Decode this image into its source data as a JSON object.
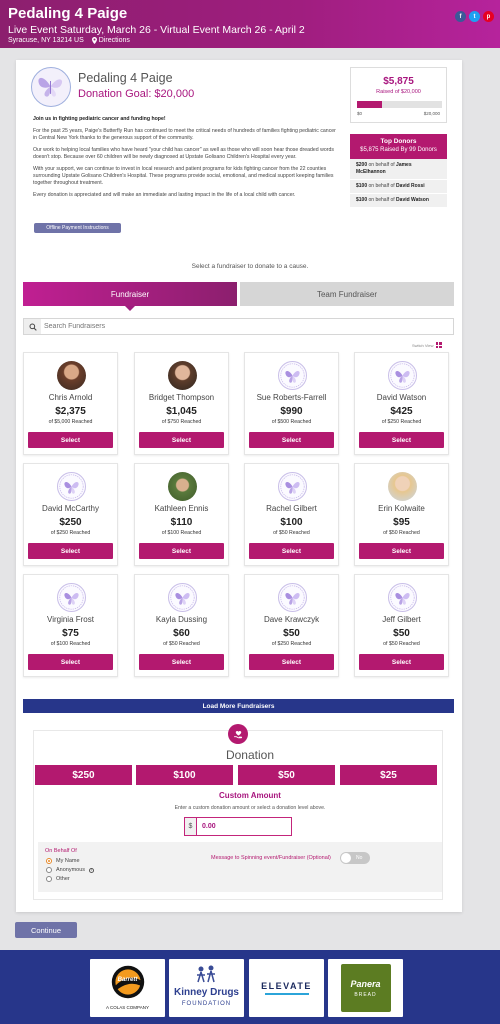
{
  "header": {
    "title": "Pedaling 4 Paige",
    "event_line": "Live Event Saturday, March 26 - Virtual Event March 26 - April 2",
    "location": "Syracuse, NY 13214 US",
    "directions": "Directions",
    "social": [
      "f",
      "t",
      "p"
    ]
  },
  "campaign": {
    "title": "Pedaling 4 Paige",
    "goal_label": "Donation Goal: $20,000",
    "story": [
      "Join us in fighting pediatric cancer and funding hope!",
      "For the past 25 years, Paige's Butterfly Run has continued to meet the critical needs of hundreds of families fighting pediatric cancer in Central New York thanks to the generous support of the community.",
      "Our work to helping local families who have heard \"your child has cancer\" as well as those who will soon hear those dreaded words doesn't stop. Because over 60 children will be newly diagnosed at Upstate Golisano Children's Hospital every year.",
      "With your support, we can continue to invest in local research and patient programs for kids fighting cancer from the 22 counties surrounding Upstate Golisano Children's Hospital. These programs provide social, emotional, and medical support keeping families together throughout treatment.",
      "Every donation is appreciated and will make an immediate and lasting impact in the life of a local child with cancer."
    ],
    "offline_button": "Offline Payment Instructions"
  },
  "progress": {
    "raised": "$5,875",
    "raised_of": "Raised of $20,000",
    "min_label": "$0",
    "max_label": "$20,000",
    "fraction": 0.294
  },
  "top_donors": {
    "title": "Top Donors",
    "subtitle": "$5,875 Raised By 99 Donors",
    "rows": [
      {
        "amount": "$200",
        "mid": " on behalf of ",
        "name": "James McElhannon"
      },
      {
        "amount": "$100",
        "mid": " on behalf of ",
        "name": "David Rossi"
      },
      {
        "amount": "$100",
        "mid": " on behalf of ",
        "name": "David Watson"
      }
    ]
  },
  "fundraiser_section": {
    "prompt": "Select a fundraiser to donate to a cause.",
    "tab_fundraiser": "Fundraiser",
    "tab_team": "Team Fundraiser",
    "search_placeholder": "Search Fundraisers",
    "switch_view": "Switch View",
    "select_label": "Select",
    "load_more": "Load More Fundraisers",
    "fundraisers": [
      {
        "name": "Chris Arnold",
        "amount": "$2,375",
        "reached": "of $5,000 Reached",
        "avatar": "photo"
      },
      {
        "name": "Bridget Thompson",
        "amount": "$1,045",
        "reached": "of $750 Reached",
        "avatar": "photo2"
      },
      {
        "name": "Sue Roberts-Farrell",
        "amount": "$990",
        "reached": "of $500 Reached",
        "avatar": "logo"
      },
      {
        "name": "David Watson",
        "amount": "$425",
        "reached": "of $250 Reached",
        "avatar": "logo"
      },
      {
        "name": "David McCarthy",
        "amount": "$250",
        "reached": "of $250 Reached",
        "avatar": "logo"
      },
      {
        "name": "Kathleen Ennis",
        "amount": "$110",
        "reached": "of $100 Reached",
        "avatar": "photo3"
      },
      {
        "name": "Rachel Gilbert",
        "amount": "$100",
        "reached": "of $50 Reached",
        "avatar": "logo"
      },
      {
        "name": "Erin Kolwaite",
        "amount": "$95",
        "reached": "of $50 Reached",
        "avatar": "photo4"
      },
      {
        "name": "Virginia Frost",
        "amount": "$75",
        "reached": "of $100 Reached",
        "avatar": "logo"
      },
      {
        "name": "Kayla Dussing",
        "amount": "$60",
        "reached": "of $50 Reached",
        "avatar": "logo"
      },
      {
        "name": "Dave Krawczyk",
        "amount": "$50",
        "reached": "of $250 Reached",
        "avatar": "logo"
      },
      {
        "name": "Jeff Gilbert",
        "amount": "$50",
        "reached": "of $50 Reached",
        "avatar": "logo"
      }
    ]
  },
  "donation": {
    "title": "Donation",
    "amounts": [
      "$250",
      "$100",
      "$50",
      "$25"
    ],
    "custom_title": "Custom Amount",
    "custom_desc": "Enter a custom donation amount or select a donation level above.",
    "currency": "$",
    "custom_value": "0.00",
    "on_behalf_title": "On Behalf Of",
    "options": [
      "My Name",
      "Anonymous",
      "Other"
    ],
    "selected_option": "My Name",
    "message_label": "Message to Spinning event/Fundraiser (Optional)",
    "toggle_label": "No",
    "continue": "Continue"
  },
  "sponsors": {
    "barrett_tagline": "A COLAS COMPANY",
    "barrett_mark": "Barrett",
    "kinney_line1": "Kinney Drugs",
    "kinney_line2": "FOUNDATION",
    "elevate": "ELEVATE",
    "panera_line1": "Panera",
    "panera_line2": "BREAD"
  },
  "colors": {
    "brand": "#a01e7f",
    "button": "#b3196f",
    "load_more": "#27368a",
    "footer": "#27368a"
  }
}
